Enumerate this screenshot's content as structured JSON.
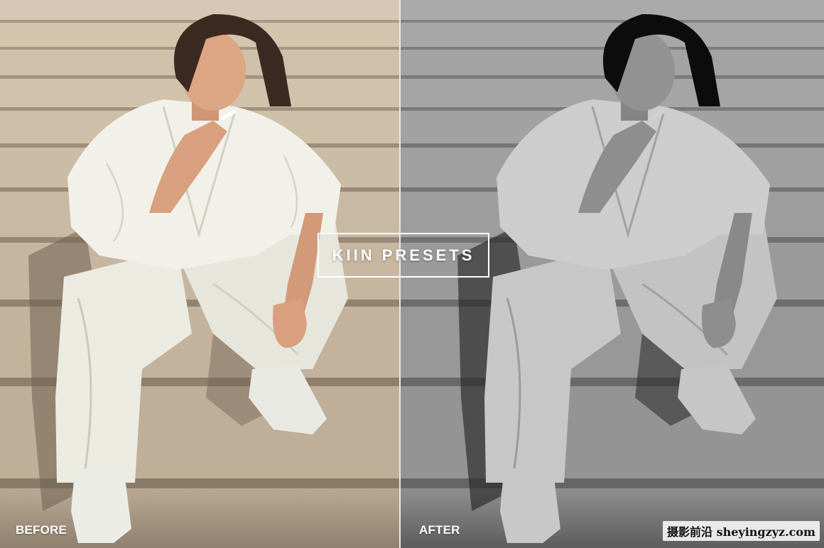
{
  "labels": {
    "before": "BEFORE",
    "after": "AFTER"
  },
  "brand": {
    "title": "KIIN PRESETS"
  },
  "watermark": {
    "text": "摄影前沿 sheyingzyz.com"
  },
  "colors": {
    "stairs_warm": "#c9b9a3",
    "stairs_shadow": "#9e8f7c",
    "garment": "#eeeee6",
    "skin": "#d8a07f",
    "hair": "#3a2a22",
    "label_text": "#ffffff"
  }
}
